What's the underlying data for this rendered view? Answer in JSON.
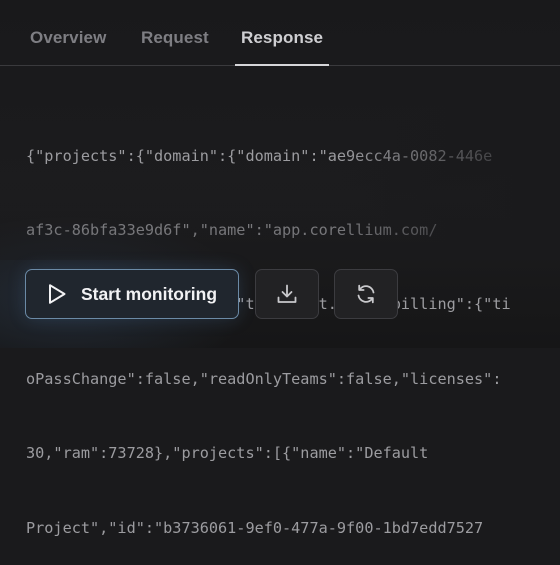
{
  "tabs": [
    {
      "label": "Overview",
      "active": false
    },
    {
      "label": "Request",
      "active": false
    },
    {
      "label": "Response",
      "active": true
    }
  ],
  "response": {
    "lines": [
      "{\"projects\":{\"domain\":{\"domain\":\"ae9ecc4a-0082-446e",
      "af3c-86bfa33e9d6f\",\"name\":\"app.corellium.com/",
      "test@test.com\",\"label\":\"test@test.com\",\"billing\":{\"ti",
      "oPassChange\":false,\"readOnlyTeams\":false,\"licenses\":",
      "30,\"ram\":73728},\"projects\":[{\"name\":\"Default",
      "Project\",\"id\":\"b3736061-9ef0-477a-9f00-1bd7edd7527"
    ]
  },
  "actions": {
    "start_label": "Start monitoring",
    "start_icon": "play-icon",
    "download_icon": "download-icon",
    "refresh_icon": "refresh-icon"
  },
  "colors": {
    "background": "#1a1a1c",
    "accent_border": "#6b8aa6",
    "active_tab": "#cfcfd2",
    "inactive_tab": "#7e7e83"
  }
}
